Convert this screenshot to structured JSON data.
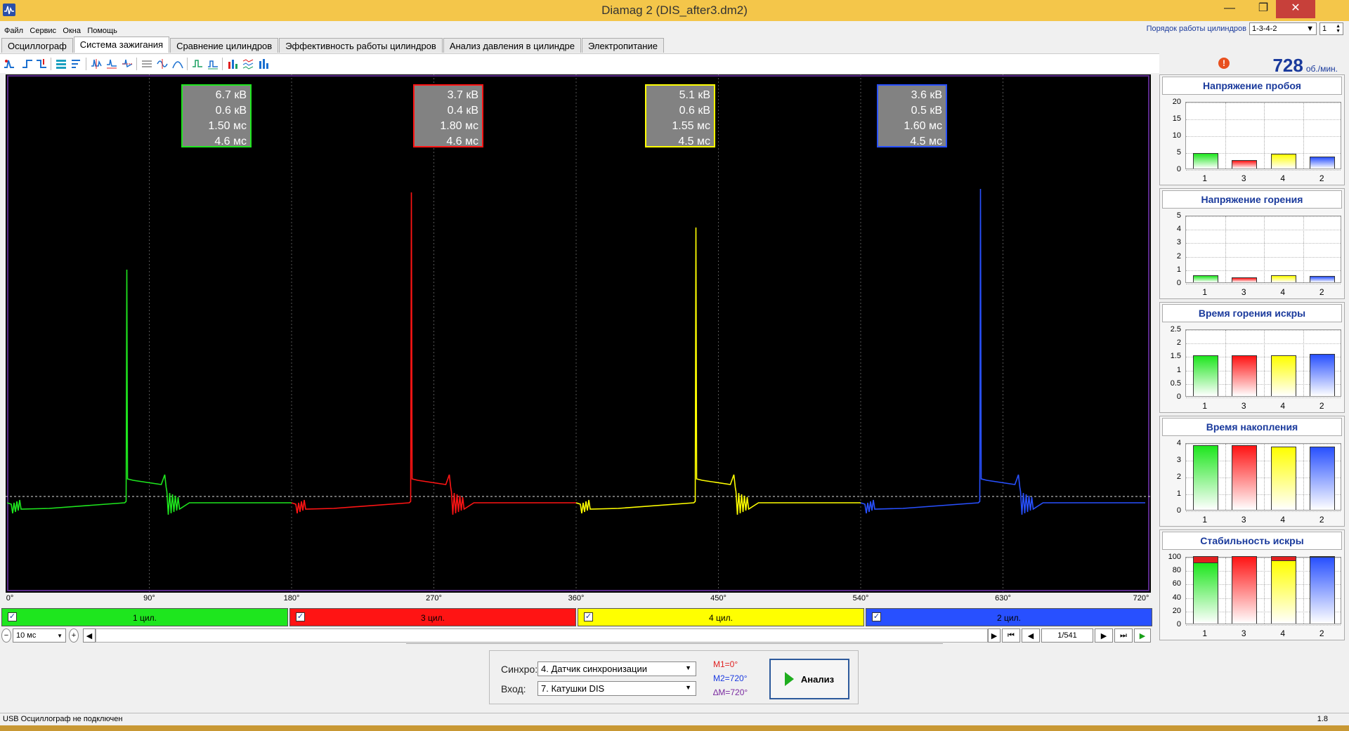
{
  "window": {
    "title": "Diamag 2 (DIS_after3.dm2)"
  },
  "menu": [
    "Файл",
    "Сервис",
    "Окна",
    "Помощь"
  ],
  "cylinder_order": {
    "label": "Порядок работы цилиндров",
    "value": "1-3-4-2",
    "index_value": "1"
  },
  "tabs": [
    {
      "label": "Осциллограф"
    },
    {
      "label": "Система зажигания",
      "active": true
    },
    {
      "label": "Сравнение цилиндров"
    },
    {
      "label": "Эффективность работы цилиндров"
    },
    {
      "label": "Анализ давления в цилиндре"
    },
    {
      "label": "Электропитание"
    }
  ],
  "rpm": {
    "value": "728",
    "unit": "об./мин."
  },
  "colors": {
    "cyl1": "#1ee61e",
    "cyl3": "#ff1414",
    "cyl4": "#ffff00",
    "cyl2": "#2850ff"
  },
  "value_boxes": [
    {
      "cyl": "1",
      "lines": [
        "6.7 кВ",
        "0.6 кВ",
        "1.50 мс",
        "4.6 мс"
      ]
    },
    {
      "cyl": "3",
      "lines": [
        "3.7 кВ",
        "0.4 кВ",
        "1.80 мс",
        "4.6 мс"
      ]
    },
    {
      "cyl": "4",
      "lines": [
        "5.1 кВ",
        "0.6 кВ",
        "1.55 мс",
        "4.5 мс"
      ]
    },
    {
      "cyl": "2",
      "lines": [
        "3.6 кВ",
        "0.5 кВ",
        "1.60 мс",
        "4.5 мс"
      ]
    }
  ],
  "degree_axis": [
    "0°",
    "90°",
    "180°",
    "270°",
    "360°",
    "450°",
    "540°",
    "630°",
    "720°"
  ],
  "cylinder_bars": [
    {
      "label": "1 цил.",
      "checked": true
    },
    {
      "label": "3 цил.",
      "checked": true
    },
    {
      "label": "4 цил.",
      "checked": true
    },
    {
      "label": "2 цил.",
      "checked": true
    }
  ],
  "nav": {
    "timebase": "10 мс",
    "page": "1/541"
  },
  "panel": {
    "sync_label": "Синхро:",
    "sync_value": "4. Датчик синхронизации",
    "input_label": "Вход:",
    "input_value": "7. Катушки DIS",
    "m1": "M1=0°",
    "m2": "M2=720°",
    "dm": "∆M=720°",
    "analyze": "Анализ"
  },
  "status": {
    "text": "USB Осциллограф не подключен",
    "version": "1.8"
  },
  "chart_data": [
    {
      "type": "bar",
      "title": "Напряжение пробоя",
      "categories": [
        "1",
        "3",
        "4",
        "2"
      ],
      "values": [
        4.6,
        2.6,
        4.3,
        3.6
      ],
      "yticks": [
        "20",
        "15",
        "10",
        "5",
        "0"
      ],
      "ylim": [
        0,
        20
      ]
    },
    {
      "type": "bar",
      "title": "Напряжение горения",
      "categories": [
        "1",
        "3",
        "4",
        "2"
      ],
      "values": [
        0.6,
        0.4,
        0.6,
        0.5
      ],
      "yticks": [
        "5",
        "4",
        "3",
        "2",
        "1",
        "0"
      ],
      "ylim": [
        0,
        5.5
      ]
    },
    {
      "type": "bar",
      "title": "Время горения искры",
      "categories": [
        "1",
        "3",
        "4",
        "2"
      ],
      "values": [
        1.5,
        1.5,
        1.5,
        1.55
      ],
      "yticks": [
        "2.5",
        "2",
        "1.5",
        "1",
        "0.5",
        "0"
      ],
      "ylim": [
        0,
        2.5
      ]
    },
    {
      "type": "bar",
      "title": "Время накопления",
      "categories": [
        "1",
        "3",
        "4",
        "2"
      ],
      "values": [
        4.6,
        4.6,
        4.5,
        4.5
      ],
      "yticks": [
        "4",
        "3",
        "2",
        "1",
        "0"
      ],
      "ylim": [
        0,
        4.8
      ]
    },
    {
      "type": "bar",
      "title": "Стабильность искры",
      "categories": [
        "1",
        "3",
        "4",
        "2"
      ],
      "values": [
        91,
        100,
        94,
        99
      ],
      "yticks": [
        "100",
        "80",
        "60",
        "40",
        "20",
        "0"
      ],
      "ylim": [
        0,
        100
      ]
    }
  ]
}
